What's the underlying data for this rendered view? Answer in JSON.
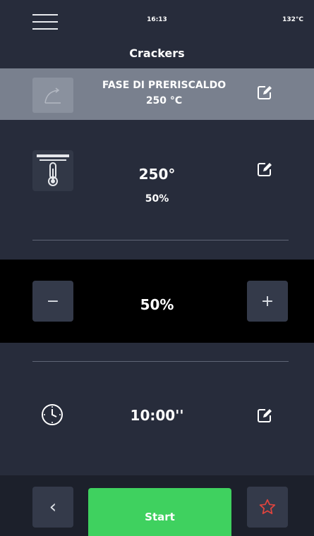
{
  "status": {
    "time": "16:13",
    "oven_temp": "132°C"
  },
  "title": "Crackers",
  "phase": {
    "name": "FASE DI PRERISCALDO",
    "temp": "250 °C"
  },
  "heat": {
    "temp": "250°",
    "power": "50%"
  },
  "power_control": {
    "value": "50%",
    "minus": "−",
    "plus": "+"
  },
  "timer": {
    "value": "10:00''"
  },
  "footer": {
    "back": "‹",
    "start": "Start"
  },
  "colors": {
    "background": "#272c3b",
    "phase_bar": "#79808e",
    "start": "#3fd15f",
    "favorite": "#e0443e"
  },
  "icons": [
    "menu-icon",
    "preheat-icon",
    "edit-icon",
    "heating-element-icon",
    "clock-icon",
    "chevron-left-icon",
    "star-icon"
  ]
}
